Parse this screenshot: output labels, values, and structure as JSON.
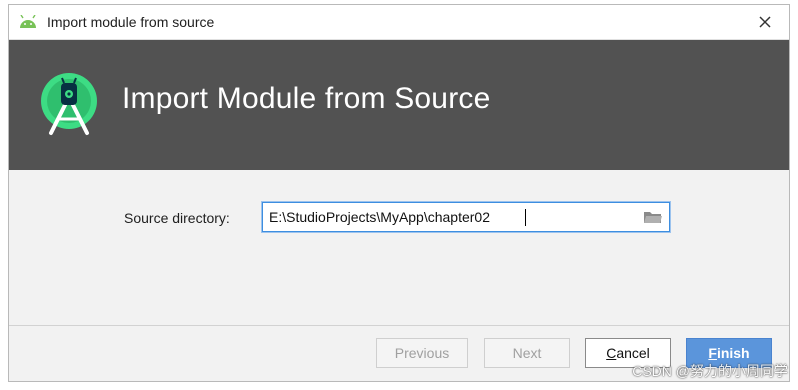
{
  "window": {
    "title": "Import module from source",
    "close_icon": "close-icon",
    "app_icon": "android-icon"
  },
  "banner": {
    "heading": "Import Module from Source",
    "logo_icon": "android-studio-logo-icon",
    "background": "#525252"
  },
  "form": {
    "source_directory": {
      "label": "Source directory:",
      "value": "E:\\StudioProjects\\MyApp\\chapter02",
      "browse_icon": "folder-icon"
    }
  },
  "footer": {
    "buttons": {
      "previous": {
        "label": "Previous",
        "enabled": false
      },
      "next": {
        "label": "Next",
        "enabled": false
      },
      "cancel": {
        "label_mnemonic": "C",
        "label_rest": "ancel",
        "enabled": true
      },
      "finish": {
        "label_mnemonic": "F",
        "label_rest": "inish",
        "enabled": true,
        "color": "#5b95db"
      }
    }
  },
  "watermark": "CSDN @努力的小周同学"
}
